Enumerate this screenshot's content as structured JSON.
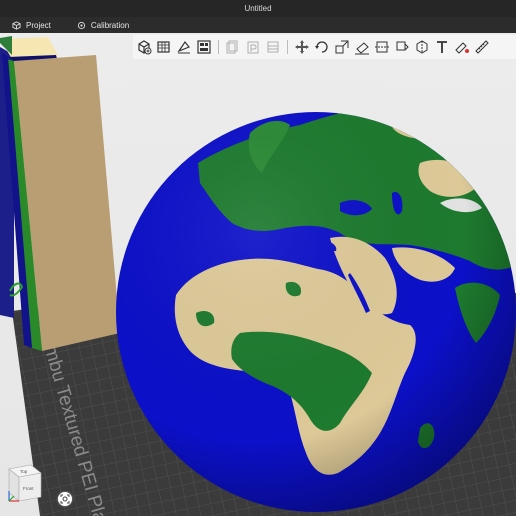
{
  "window": {
    "title": "Untitled"
  },
  "menubar": {
    "items": [
      {
        "label": "Project",
        "icon": "cube-icon"
      },
      {
        "label": "Calibration",
        "icon": "calibration-icon"
      }
    ]
  },
  "viewport": {
    "plate_label": "Bambu Textured PEI Plate",
    "navcube_label": "Top",
    "navcube_side": "Front"
  },
  "toolbar": {
    "icons": [
      "add-object-icon",
      "add-plate-icon",
      "auto-orient-icon",
      "arrange-icon",
      "copy-icon",
      "paste-icon",
      "split-icon",
      "move-icon",
      "rotate-icon",
      "scale-icon",
      "lay-on-face-icon",
      "cut-icon",
      "support-paint-icon",
      "seam-paint-icon",
      "text-icon",
      "color-paint-icon",
      "measure-icon"
    ]
  },
  "colors": {
    "ocean": "#0c10c8",
    "land_green": "#1d7a2e",
    "land_tan": "#ddc998",
    "tower": "#b89e72",
    "bed": "#3b3b3b"
  }
}
